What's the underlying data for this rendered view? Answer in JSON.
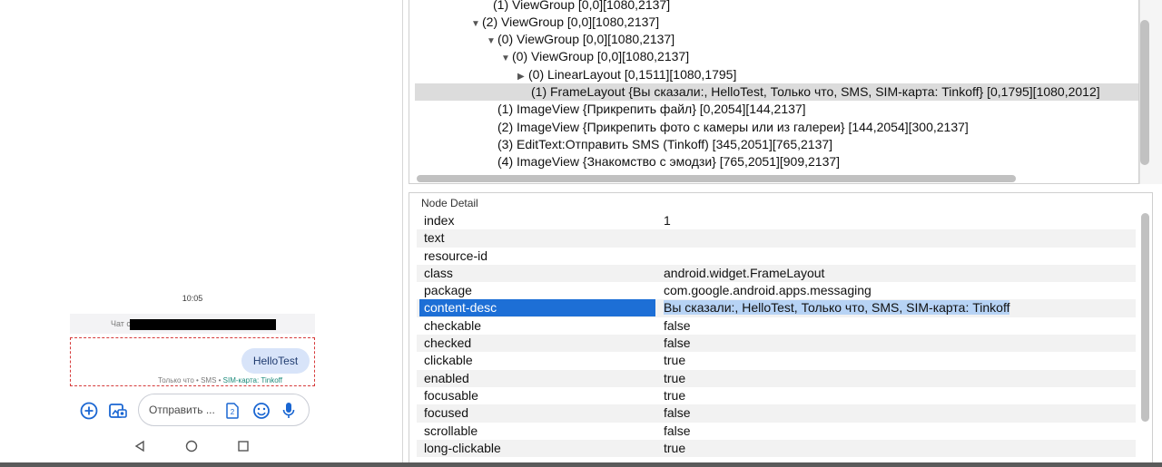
{
  "device": {
    "clock": "10:05",
    "chat_header_prefix": "Чат с",
    "message": {
      "text": "HelloTest",
      "meta_prefix": "Только что • SMS • ",
      "meta_sim": "SIM-карта: Tinkoff"
    },
    "compose_placeholder": "Отправить ...",
    "sim_badge": "2",
    "icons": [
      "add-circle-icon",
      "gallery-camera-icon",
      "sim-card-icon",
      "emoji-icon",
      "microphone-icon",
      "back-icon",
      "home-icon",
      "recents-icon"
    ]
  },
  "tree": {
    "rows": [
      {
        "text": "(1) ViewGroup [0,0][1080,2137]",
        "toggle": ""
      },
      {
        "text": "(2) ViewGroup [0,0][1080,2137]",
        "toggle": "▼"
      },
      {
        "text": "(0) ViewGroup [0,0][1080,2137]",
        "toggle": "▼"
      },
      {
        "text": "(0) ViewGroup [0,0][1080,2137]",
        "toggle": "▼"
      },
      {
        "text": "(0) LinearLayout [0,1511][1080,1795]",
        "toggle": "▶"
      },
      {
        "text": "(1) FrameLayout {Вы сказали:, HelloTest, Только что, SMS, SIM-карта: Tinkoff} [0,1795][1080,2012]",
        "toggle": "",
        "selected": true
      },
      {
        "text": "(1) ImageView {Прикрепить файл} [0,2054][144,2137]",
        "toggle": ""
      },
      {
        "text": "(2) ImageView {Прикрепить фото с камеры или из галереи} [144,2054][300,2137]",
        "toggle": ""
      },
      {
        "text": "(3) EditText:Отправить SMS (Tinkoff) [345,2051][765,2137]",
        "toggle": ""
      },
      {
        "text": "(4) ImageView {Знакомство с эмодзи} [765,2051][909,2137]",
        "toggle": ""
      }
    ]
  },
  "detail": {
    "title": "Node Detail",
    "rows": [
      {
        "key": "index",
        "value": "1"
      },
      {
        "key": "text",
        "value": ""
      },
      {
        "key": "resource-id",
        "value": ""
      },
      {
        "key": "class",
        "value": "android.widget.FrameLayout"
      },
      {
        "key": "package",
        "value": "com.google.android.apps.messaging"
      },
      {
        "key": "content-desc",
        "value": "Вы сказали:, HelloTest, Только что, SMS, SIM-карта: Tinkoff",
        "selected": true
      },
      {
        "key": "checkable",
        "value": "false"
      },
      {
        "key": "checked",
        "value": "false"
      },
      {
        "key": "clickable",
        "value": "true"
      },
      {
        "key": "enabled",
        "value": "true"
      },
      {
        "key": "focusable",
        "value": "true"
      },
      {
        "key": "focused",
        "value": "false"
      },
      {
        "key": "scrollable",
        "value": "false"
      },
      {
        "key": "long-clickable",
        "value": "true"
      }
    ]
  },
  "colors": {
    "accent": "#1d6fd6",
    "device_icon": "#1a66d2",
    "selection_box": "#d63a3a",
    "bubble": "#d8e4f9",
    "sim_text": "#1b8a7a"
  }
}
